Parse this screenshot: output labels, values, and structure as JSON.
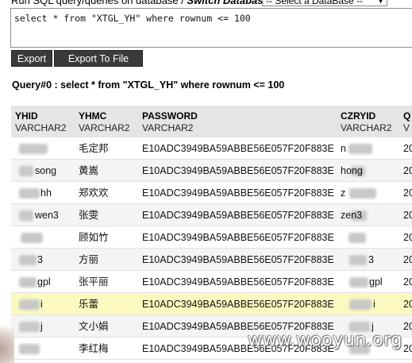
{
  "header": {
    "run_label": "Run SQL query/queries on database /",
    "switch_label": "Switch Database :",
    "db_select_value": "-- Select a DataBase --"
  },
  "sql_editor": {
    "value": "select * from \"XTGL_YH\" where rownum <= 100"
  },
  "buttons": {
    "export": "Export",
    "export_to_file": "Export To File"
  },
  "query_title": "Query#0 : select * from \"XTGL_YH\" where rownum <= 100",
  "table": {
    "columns": [
      {
        "name": "YHID",
        "type": "VARCHAR2"
      },
      {
        "name": "YHMC",
        "type": "VARCHAR2"
      },
      {
        "name": "PASSWORD",
        "type": "VARCHAR2"
      },
      {
        "name": "CZRYID",
        "type": "VARCHAR2"
      },
      {
        "name": "Q",
        "type": "V"
      }
    ],
    "rows": [
      {
        "yhid": "",
        "yhmc": "毛定邦",
        "password": "E10ADC3949BA59ABBE56E057F20F883E",
        "czryid": "n",
        "q": "20"
      },
      {
        "yhid": "song",
        "yhmc": "黄嵩",
        "password": "E10ADC3949BA59ABBE56E057F20F883E",
        "czryid": "hong",
        "q": "20"
      },
      {
        "yhid": "hh",
        "yhmc": "郑欢欢",
        "password": "E10ADC3949BA59ABBE56E057F20F883E",
        "czryid": "z",
        "q": "20"
      },
      {
        "yhid": "wen3",
        "yhmc": "张雯",
        "password": "E10ADC3949BA59ABBE56E057F20F883E",
        "czryid": "zen3",
        "q": "20"
      },
      {
        "yhid": "",
        "yhmc": "顾如竹",
        "password": "E10ADC3949BA59ABBE56E057F20F883E",
        "czryid": "",
        "q": "20"
      },
      {
        "yhid": "3",
        "yhmc": "方丽",
        "password": "E10ADC3949BA59ABBE56E057F20F883E",
        "czryid": "3",
        "q": "20"
      },
      {
        "yhid": "gpl",
        "yhmc": "张平丽",
        "password": "E10ADC3949BA59ABBE56E057F20F883E",
        "czryid": "gpl",
        "q": "20"
      },
      {
        "yhid": "i",
        "yhmc": "乐蕾",
        "password": "E10ADC3949BA59ABBE56E057F20F883E",
        "czryid": "i",
        "q": "20"
      },
      {
        "yhid": "j",
        "yhmc": "文小娟",
        "password": "E10ADC3949BA59ABBE56E057F20F883E",
        "czryid": "j",
        "q": "20"
      },
      {
        "yhid": "",
        "yhmc": "李红梅",
        "password": "E10ADC3949BA59ABBE56E057F20F883E",
        "czryid": "",
        "q": "20"
      }
    ]
  },
  "watermark": "www.wooyun.org",
  "colors": {
    "button_bg": "#3a3a3a",
    "header_bg": "#e5e5e5",
    "highlight_row": "#fafac0"
  }
}
